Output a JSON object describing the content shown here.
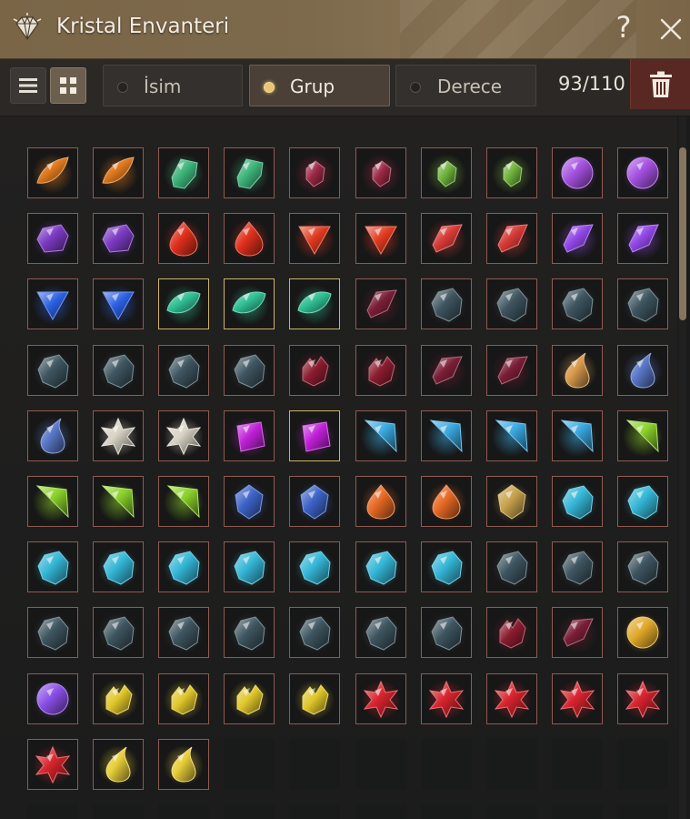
{
  "window": {
    "title": "Kristal Envanteri",
    "logo_icon": "diamond-icon",
    "help_label": "?",
    "close_icon": "close-icon"
  },
  "toolbar": {
    "view_list_icon": "list-view-icon",
    "view_grid_icon": "grid-view-icon",
    "active_view": "grid",
    "tabs": [
      {
        "label": "İsim",
        "active": false
      },
      {
        "label": "Grup",
        "active": true
      },
      {
        "label": "Derece",
        "active": false
      }
    ],
    "count": "93/110",
    "trash_icon": "trash-icon"
  },
  "colors": {
    "title_bar": "#7a6547",
    "slot_border": "#8e5b52",
    "selected_border": "#cdb36a",
    "delete_bg": "#5a2823"
  },
  "inventory": {
    "columns": 10,
    "visible_rows": 11,
    "capacity": 110,
    "used": 93,
    "slots": [
      {
        "gem": "orange-sparkle-gem-icon",
        "color": "#e07a1e",
        "shape": "marquise"
      },
      {
        "gem": "orange-sparkle-gem-icon",
        "color": "#e07a1e",
        "shape": "marquise"
      },
      {
        "gem": "green-blue-shard-gem-icon",
        "color": "#3db37a",
        "shape": "shard"
      },
      {
        "gem": "green-blue-shard-gem-icon",
        "color": "#3db37a",
        "shape": "shard"
      },
      {
        "gem": "dark-red-gem-icon",
        "color": "#9c2846",
        "shape": "small"
      },
      {
        "gem": "dark-red-gem-icon",
        "color": "#9c2846",
        "shape": "small"
      },
      {
        "gem": "green-gem-icon",
        "color": "#6fb23a",
        "shape": "small"
      },
      {
        "gem": "green-gem-icon",
        "color": "#6fb23a",
        "shape": "small"
      },
      {
        "gem": "purple-orb-gem-icon",
        "color": "#a450e0",
        "shape": "round"
      },
      {
        "gem": "purple-orb-gem-icon",
        "color": "#a450e0",
        "shape": "round"
      },
      {
        "gem": "purple-hexagon-gem-icon",
        "color": "#7d3bc4",
        "shape": "hexagon"
      },
      {
        "gem": "purple-hexagon-gem-icon",
        "color": "#7d3bc4",
        "shape": "hexagon"
      },
      {
        "gem": "red-drop-gem-icon",
        "color": "#e0301c",
        "shape": "drop"
      },
      {
        "gem": "red-drop-gem-icon",
        "color": "#e0301c",
        "shape": "drop"
      },
      {
        "gem": "red-triangle-gem-icon",
        "color": "#e03a1e",
        "shape": "triangle"
      },
      {
        "gem": "red-triangle-gem-icon",
        "color": "#e03a1e",
        "shape": "triangle"
      },
      {
        "gem": "red-shard-gem-icon",
        "color": "#d63a36",
        "shape": "slab"
      },
      {
        "gem": "red-shard-gem-icon",
        "color": "#d63a36",
        "shape": "slab"
      },
      {
        "gem": "violet-shard-gem-icon",
        "color": "#9147e6",
        "shape": "slab"
      },
      {
        "gem": "violet-shard-gem-icon",
        "color": "#9147e6",
        "shape": "slab"
      },
      {
        "gem": "blue-triangle-gem-icon",
        "color": "#2a5fe0",
        "shape": "triangle"
      },
      {
        "gem": "blue-triangle-gem-icon",
        "color": "#2a5fe0",
        "shape": "triangle"
      },
      {
        "gem": "teal-oval-gem-icon",
        "color": "#2fbf93",
        "shape": "oval",
        "selected": true
      },
      {
        "gem": "teal-oval-gem-icon",
        "color": "#2fbf93",
        "shape": "oval",
        "selected": true
      },
      {
        "gem": "teal-oval-gem-icon",
        "color": "#2fbf93",
        "shape": "oval",
        "selected": true
      },
      {
        "gem": "dark-ruby-gem-icon",
        "color": "#7a1e36",
        "shape": "slab"
      },
      {
        "gem": "dark-crystal-gem-icon",
        "color": "#3e5560",
        "shape": "rough"
      },
      {
        "gem": "dark-crystal-gem-icon",
        "color": "#3e5560",
        "shape": "rough"
      },
      {
        "gem": "dark-crystal-gem-icon",
        "color": "#3e5560",
        "shape": "rough"
      },
      {
        "gem": "dark-crystal-gem-icon",
        "color": "#3e5560",
        "shape": "rough"
      },
      {
        "gem": "dark-crystal-gem-icon",
        "color": "#3e5560",
        "shape": "rough"
      },
      {
        "gem": "dark-crystal-gem-icon",
        "color": "#3e5560",
        "shape": "rough"
      },
      {
        "gem": "dark-crystal-gem-icon",
        "color": "#3e5560",
        "shape": "rough"
      },
      {
        "gem": "dark-crystal-gem-icon",
        "color": "#3e5560",
        "shape": "rough"
      },
      {
        "gem": "dark-red-cluster-gem-icon",
        "color": "#8c1c30",
        "shape": "cluster"
      },
      {
        "gem": "dark-red-cluster-gem-icon",
        "color": "#8c1c30",
        "shape": "cluster"
      },
      {
        "gem": "dark-ruby-gem-icon",
        "color": "#7a1e36",
        "shape": "slab"
      },
      {
        "gem": "dark-ruby-gem-icon",
        "color": "#7a1e36",
        "shape": "slab"
      },
      {
        "gem": "amber-drop-gem-icon",
        "color": "#d89a4a",
        "shape": "tear"
      },
      {
        "gem": "blue-drop-gem-icon",
        "color": "#5a78c8",
        "shape": "tear"
      },
      {
        "gem": "blue-drop-gem-icon",
        "color": "#5a78c8",
        "shape": "tear"
      },
      {
        "gem": "silver-star-gem-icon",
        "color": "#d8d2c4",
        "shape": "star"
      },
      {
        "gem": "silver-star-gem-icon",
        "color": "#d8d2c4",
        "shape": "star"
      },
      {
        "gem": "magenta-gem-icon",
        "color": "#c020d8",
        "shape": "square"
      },
      {
        "gem": "magenta-gem-icon",
        "color": "#c020d8",
        "shape": "square",
        "selected": true
      },
      {
        "gem": "cyan-kite-gem-icon",
        "color": "#3aa8e0",
        "shape": "kite"
      },
      {
        "gem": "cyan-kite-gem-icon",
        "color": "#3aa8e0",
        "shape": "kite"
      },
      {
        "gem": "cyan-kite-gem-icon",
        "color": "#3aa8e0",
        "shape": "kite"
      },
      {
        "gem": "cyan-kite-gem-icon",
        "color": "#3aa8e0",
        "shape": "kite"
      },
      {
        "gem": "lime-kite-gem-icon",
        "color": "#8ad12a",
        "shape": "kite"
      },
      {
        "gem": "lime-kite-gem-icon",
        "color": "#8ad12a",
        "shape": "kite"
      },
      {
        "gem": "lime-kite-gem-icon",
        "color": "#8ad12a",
        "shape": "kite"
      },
      {
        "gem": "lime-kite-gem-icon",
        "color": "#8ad12a",
        "shape": "kite"
      },
      {
        "gem": "blue-faceted-gem-icon",
        "color": "#3d63c8",
        "shape": "faceted"
      },
      {
        "gem": "blue-faceted-gem-icon",
        "color": "#3d63c8",
        "shape": "faceted"
      },
      {
        "gem": "orange-drop-gem-icon",
        "color": "#e86a24",
        "shape": "drop"
      },
      {
        "gem": "orange-drop-gem-icon",
        "color": "#e86a24",
        "shape": "drop"
      },
      {
        "gem": "black-gold-gem-icon",
        "color": "#c6a14a",
        "shape": "faceted"
      },
      {
        "gem": "aqua-gem-icon",
        "color": "#34b6d6",
        "shape": "rough"
      },
      {
        "gem": "aqua-gem-icon",
        "color": "#34b6d6",
        "shape": "rough"
      },
      {
        "gem": "aqua-gem-icon",
        "color": "#34b6d6",
        "shape": "rough"
      },
      {
        "gem": "aqua-gem-icon",
        "color": "#34b6d6",
        "shape": "rough"
      },
      {
        "gem": "aqua-gem-icon",
        "color": "#34b6d6",
        "shape": "rough"
      },
      {
        "gem": "aqua-gem-icon",
        "color": "#34b6d6",
        "shape": "rough"
      },
      {
        "gem": "aqua-gem-icon",
        "color": "#34b6d6",
        "shape": "rough"
      },
      {
        "gem": "aqua-gem-icon",
        "color": "#34b6d6",
        "shape": "rough"
      },
      {
        "gem": "aqua-gem-icon",
        "color": "#34b6d6",
        "shape": "rough"
      },
      {
        "gem": "dark-crystal-gem-icon",
        "color": "#3e5560",
        "shape": "rough"
      },
      {
        "gem": "dark-crystal-gem-icon",
        "color": "#3e5560",
        "shape": "rough"
      },
      {
        "gem": "dark-crystal-gem-icon",
        "color": "#3e5560",
        "shape": "rough"
      },
      {
        "gem": "dark-crystal-gem-icon",
        "color": "#3e5560",
        "shape": "rough"
      },
      {
        "gem": "dark-crystal-gem-icon",
        "color": "#3e5560",
        "shape": "rough"
      },
      {
        "gem": "dark-crystal-gem-icon",
        "color": "#3e5560",
        "shape": "rough"
      },
      {
        "gem": "dark-crystal-gem-icon",
        "color": "#3e5560",
        "shape": "rough"
      },
      {
        "gem": "dark-crystal-gem-icon",
        "color": "#3e5560",
        "shape": "rough"
      },
      {
        "gem": "dark-crystal-gem-icon",
        "color": "#3e5560",
        "shape": "rough"
      },
      {
        "gem": "dark-crystal-gem-icon",
        "color": "#3e5560",
        "shape": "rough"
      },
      {
        "gem": "dark-red-cluster-gem-icon",
        "color": "#8c1c30",
        "shape": "cluster"
      },
      {
        "gem": "dark-ruby-gem-icon",
        "color": "#7a1e36",
        "shape": "slab"
      },
      {
        "gem": "gold-orb-gem-icon",
        "color": "#e0a82a",
        "shape": "round"
      },
      {
        "gem": "purple-orb-gem-icon",
        "color": "#8a4ee6",
        "shape": "round"
      },
      {
        "gem": "yellow-cluster-gem-icon",
        "color": "#e0c62a",
        "shape": "cluster"
      },
      {
        "gem": "yellow-cluster-gem-icon",
        "color": "#e0c62a",
        "shape": "cluster"
      },
      {
        "gem": "yellow-cluster-gem-icon",
        "color": "#e0c62a",
        "shape": "cluster"
      },
      {
        "gem": "yellow-cluster-gem-icon",
        "color": "#e0c62a",
        "shape": "cluster"
      },
      {
        "gem": "red-star-gem-icon",
        "color": "#d8242e",
        "shape": "star"
      },
      {
        "gem": "red-star-gem-icon",
        "color": "#d8242e",
        "shape": "star"
      },
      {
        "gem": "red-star-gem-icon",
        "color": "#d8242e",
        "shape": "star"
      },
      {
        "gem": "red-star-gem-icon",
        "color": "#d8242e",
        "shape": "star"
      },
      {
        "gem": "red-star-gem-icon",
        "color": "#d8242e",
        "shape": "star"
      },
      {
        "gem": "red-star-gem-icon",
        "color": "#d8242e",
        "shape": "star"
      },
      {
        "gem": "yellow-drop-gem-icon",
        "color": "#e8cf3a",
        "shape": "tear"
      },
      {
        "gem": "yellow-drop-gem-icon",
        "color": "#e8cf3a",
        "shape": "tear"
      }
    ]
  }
}
